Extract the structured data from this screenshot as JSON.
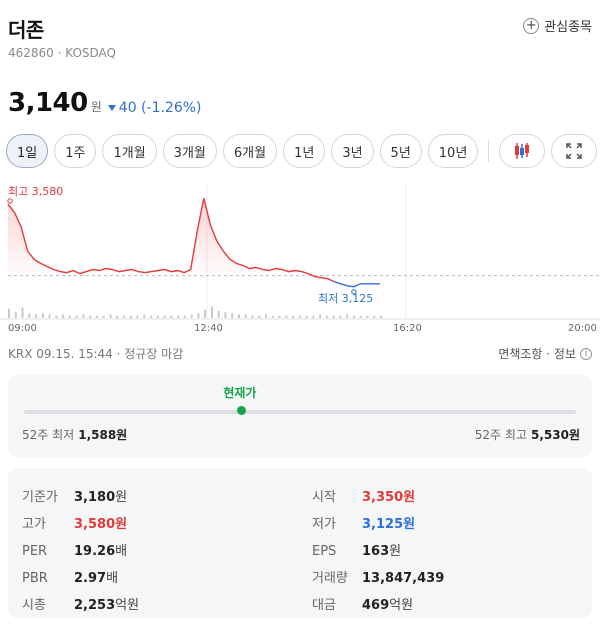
{
  "stock": {
    "name": "더존",
    "code_line": "462860 · KOSDAQ",
    "watch_label": "관심종목"
  },
  "price": {
    "value": "3,140",
    "unit": "원",
    "change": "40 (-1.26%)",
    "direction": "down"
  },
  "periods": [
    "1일",
    "1주",
    "1개월",
    "3개월",
    "6개월",
    "1년",
    "3년",
    "5년",
    "10년"
  ],
  "active_period": "1일",
  "chart_data": {
    "type": "line",
    "x_ticks": [
      "09:00",
      "12:40",
      "16:20",
      "20:00"
    ],
    "high_label": "최고 3,580",
    "low_label": "최저 3,125",
    "base_price": 3180,
    "ylim": [
      3080,
      3620
    ],
    "series": [
      {
        "values": [
          3530,
          3490,
          3420,
          3300,
          3260,
          3240,
          3225,
          3210,
          3200,
          3195,
          3205,
          3190,
          3200,
          3210,
          3205,
          3215,
          3210,
          3200,
          3205,
          3210,
          3200,
          3195,
          3200,
          3205,
          3210,
          3200,
          3205,
          3195,
          3210,
          3400,
          3560,
          3430,
          3350,
          3300,
          3260,
          3240,
          3230,
          3215,
          3220,
          3210,
          3205,
          3215,
          3210,
          3200,
          3205,
          3200,
          3190,
          3175,
          3170,
          3165,
          3150
        ]
      },
      {
        "values": [
          3150,
          3140,
          3130,
          3125,
          3140,
          3140,
          3140,
          3140
        ]
      }
    ],
    "volume": [
      8,
      5,
      9,
      4,
      3,
      4,
      3,
      2,
      3,
      2,
      2,
      3,
      2,
      2,
      2,
      3,
      2,
      2,
      2,
      2,
      3,
      2,
      2,
      2,
      2,
      2,
      2,
      3,
      4,
      7,
      10,
      6,
      5,
      4,
      3,
      3,
      2,
      2,
      3,
      2,
      2,
      2,
      2,
      2,
      2,
      2,
      3,
      2,
      2,
      2,
      3,
      2,
      2,
      2,
      2,
      2
    ]
  },
  "info": {
    "timestamp": "KRX 09.15. 15:44 · 정규장 마감",
    "disclaimer": "면책조항 · 정보"
  },
  "range52": {
    "current_label": "현재가",
    "low_label": "52주 최저",
    "low_value": "1,588원",
    "high_label": "52주 최고",
    "high_value": "5,530원",
    "low": 1588,
    "high": 5530,
    "current": 3140
  },
  "stats": {
    "base": {
      "label": "기준가",
      "value": "3,180",
      "unit": "원"
    },
    "high": {
      "label": "고가",
      "value": "3,580",
      "unit": "원"
    },
    "per": {
      "label": "PER",
      "value": "19.26",
      "unit": "배"
    },
    "pbr": {
      "label": "PBR",
      "value": "2.97",
      "unit": "배"
    },
    "mcap": {
      "label": "시총",
      "value": "2,253",
      "unit": "억원"
    },
    "open": {
      "label": "시작",
      "value": "3,350",
      "unit": "원"
    },
    "low": {
      "label": "저가",
      "value": "3,125",
      "unit": "원"
    },
    "eps": {
      "label": "EPS",
      "value": "163",
      "unit": "원"
    },
    "volume": {
      "label": "거래량",
      "value": "13,847,439",
      "unit": ""
    },
    "amount": {
      "label": "대금",
      "value": "469",
      "unit": "억원"
    }
  },
  "colors": {
    "up": "#e23a3a",
    "down": "#2f6fd6",
    "accent": "#16a34a"
  }
}
